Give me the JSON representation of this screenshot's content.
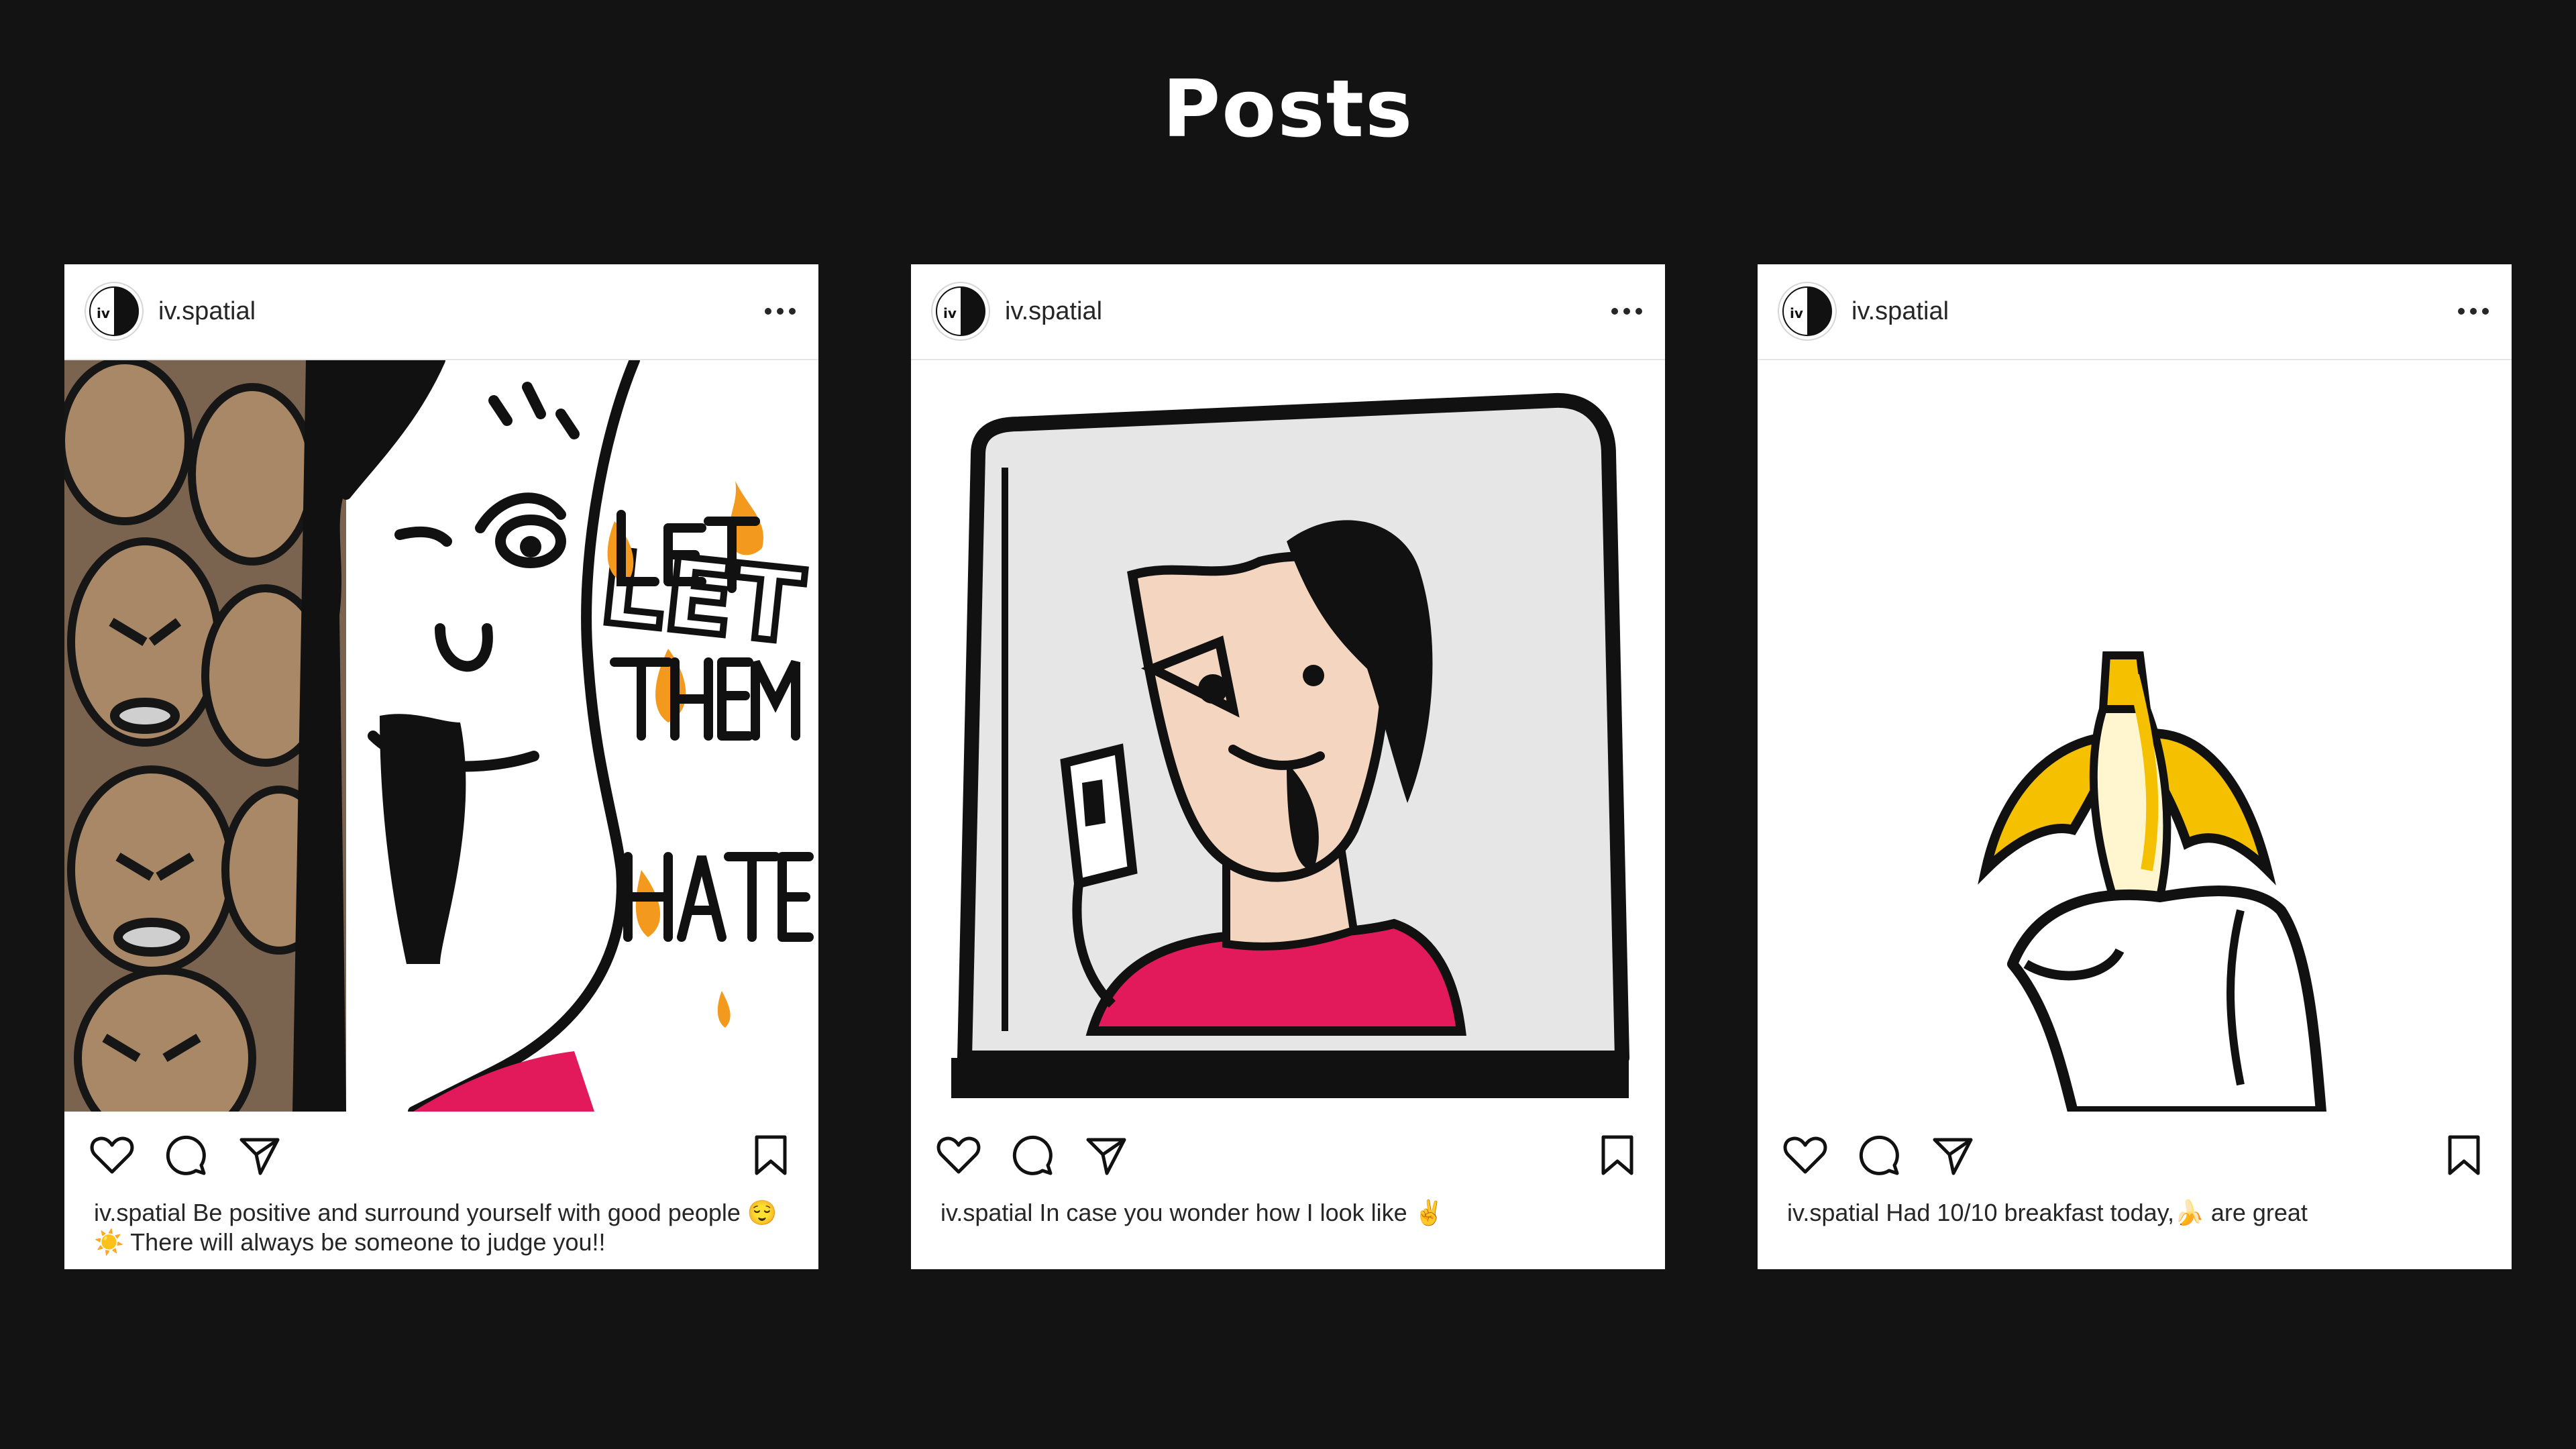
{
  "page": {
    "title": "Posts"
  },
  "colors": {
    "background": "#131313",
    "card": "#ffffff",
    "accent_pink": "#e2195a",
    "accent_yellow": "#f5c000",
    "accent_orange": "#f39a1e"
  },
  "posts": [
    {
      "username": "iv.spatial",
      "avatar_icon": "iv-logo-icon",
      "caption_user": "iv.spatial",
      "caption_text": " Be positive and surround yourself with good people 😌☀️ There will always be someone to judge you!!",
      "artwork": "let-them-hate-drawing",
      "artwork_text": "LET THEM HATE"
    },
    {
      "username": "iv.spatial",
      "avatar_icon": "iv-logo-icon",
      "caption_user": "iv.spatial",
      "caption_text": " In case you wonder how I look like ✌️",
      "artwork": "mirror-selfie-drawing"
    },
    {
      "username": "iv.spatial",
      "avatar_icon": "iv-logo-icon",
      "caption_user": "iv.spatial",
      "caption_text": " Had 10/10 breakfast today,🍌 are great",
      "artwork": "banana-drawing"
    }
  ],
  "icons": {
    "like": "heart-icon",
    "comment": "comment-icon",
    "share": "paper-plane-icon",
    "save": "bookmark-icon",
    "more": "more-dots-icon"
  }
}
